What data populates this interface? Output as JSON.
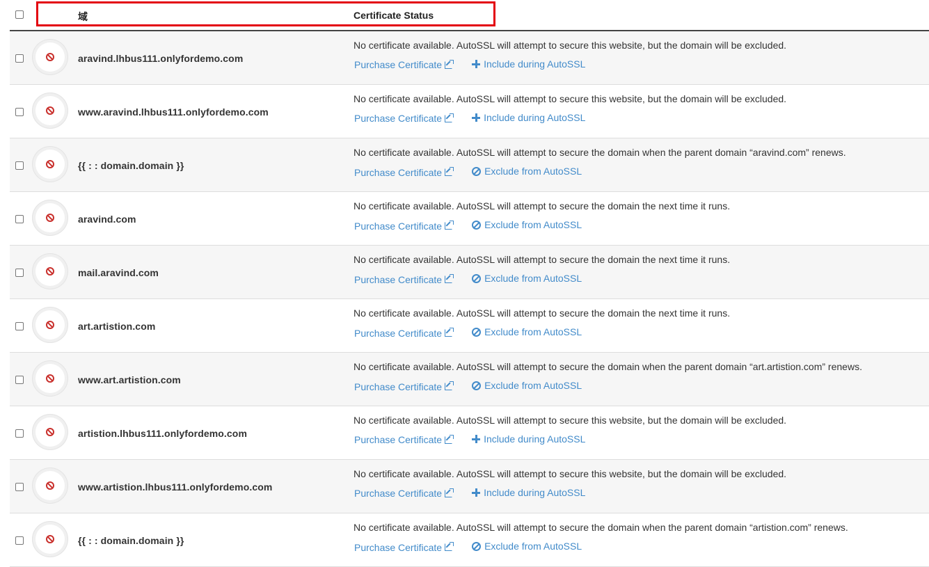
{
  "header": {
    "domain_label": "域",
    "status_label": "Certificate Status"
  },
  "colors": {
    "highlight_box": "#e3000f",
    "link": "#428bca",
    "error_icon": "#c9302c"
  },
  "rows": [
    {
      "domain": "aravind.lhbus111.onlyfordemo.com",
      "message": "No certificate available. AutoSSL will attempt to secure this website, but the domain will be excluded.",
      "purchase_label": "Purchase Certificate",
      "action_label": "Include during AutoSSL",
      "action_icon": "plus-icon"
    },
    {
      "domain": "www.aravind.lhbus111.onlyfordemo.com",
      "message": "No certificate available. AutoSSL will attempt to secure this website, but the domain will be excluded.",
      "purchase_label": "Purchase Certificate",
      "action_label": "Include during AutoSSL",
      "action_icon": "plus-icon"
    },
    {
      "domain": "{{ :  :   domain.domain }}",
      "message": "No certificate available. AutoSSL will attempt to secure the domain when the parent domain “aravind.com” renews.",
      "purchase_label": "Purchase Certificate",
      "action_label": "Exclude from AutoSSL",
      "action_icon": "exclude-icon"
    },
    {
      "domain": "aravind.com",
      "message": "No certificate available. AutoSSL will attempt to secure the domain the next time it runs.",
      "purchase_label": "Purchase Certificate",
      "action_label": "Exclude from AutoSSL",
      "action_icon": "exclude-icon"
    },
    {
      "domain": "mail.aravind.com",
      "message": "No certificate available. AutoSSL will attempt to secure the domain the next time it runs.",
      "purchase_label": "Purchase Certificate",
      "action_label": "Exclude from AutoSSL",
      "action_icon": "exclude-icon"
    },
    {
      "domain": "art.artistion.com",
      "message": "No certificate available. AutoSSL will attempt to secure the domain the next time it runs.",
      "purchase_label": "Purchase Certificate",
      "action_label": "Exclude from AutoSSL",
      "action_icon": "exclude-icon"
    },
    {
      "domain": "www.art.artistion.com",
      "message": "No certificate available. AutoSSL will attempt to secure the domain when the parent domain “art.artistion.com” renews.",
      "purchase_label": "Purchase Certificate",
      "action_label": "Exclude from AutoSSL",
      "action_icon": "exclude-icon"
    },
    {
      "domain": "artistion.lhbus111.onlyfordemo.com",
      "message": "No certificate available. AutoSSL will attempt to secure this website, but the domain will be excluded.",
      "purchase_label": "Purchase Certificate",
      "action_label": "Include during AutoSSL",
      "action_icon": "plus-icon"
    },
    {
      "domain": "www.artistion.lhbus111.onlyfordemo.com",
      "message": "No certificate available. AutoSSL will attempt to secure this website, but the domain will be excluded.",
      "purchase_label": "Purchase Certificate",
      "action_label": "Include during AutoSSL",
      "action_icon": "plus-icon"
    },
    {
      "domain": "{{ :  :   domain.domain }}",
      "message": "No certificate available. AutoSSL will attempt to secure the domain when the parent domain “artistion.com” renews.",
      "purchase_label": "Purchase Certificate",
      "action_label": "Exclude from AutoSSL",
      "action_icon": "exclude-icon"
    }
  ]
}
